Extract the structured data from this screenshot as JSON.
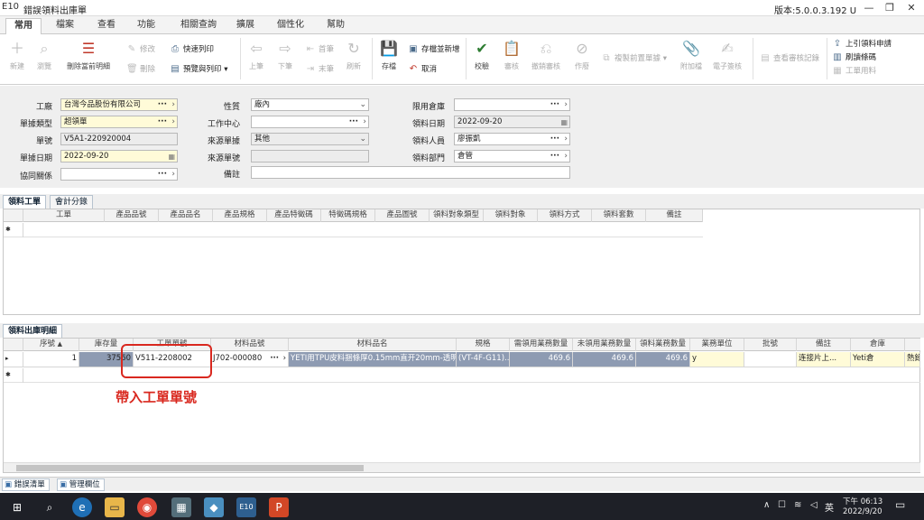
{
  "window": {
    "logo": "E10",
    "title": "錯誤領料出庫單",
    "version": "版本:5.0.0.3.192 U",
    "min": "—",
    "restore": "❐",
    "close": "✕"
  },
  "menu": [
    "常用",
    "檔案",
    "查看",
    "功能",
    "相關查詢",
    "擴展",
    "個性化",
    "幫助"
  ],
  "ribbon": {
    "new": "新建",
    "browse": "瀏覽",
    "delete_current": "刪除當前明細",
    "modify": "修改",
    "remove": "刪除",
    "quick_print": "快速列印",
    "preview_print": "預覽與列印",
    "prev": "上筆",
    "next": "下筆",
    "first": "首筆",
    "last": "末筆",
    "refresh": "刷新",
    "save": "存檔",
    "save_new": "存檔並新增",
    "cancel": "取消",
    "validate": "校驗",
    "review": "審核",
    "unreview": "撤銷審核",
    "void": "作廢",
    "copy_prev": "複製前置單據",
    "attach": "附加檔",
    "esign": "電子簽核",
    "view_review": "查看審核記錄",
    "cite_request": "上引領料申請",
    "barcode": "刷讀條碼",
    "wo_material": "工單用料"
  },
  "form": {
    "factory_label": "工廠",
    "factory": "台灣今品股份有限公司",
    "doctype_label": "單據類型",
    "doctype": "超領單",
    "docno_label": "單號",
    "docno": "V5A1-220920004",
    "docdate_label": "單據日期",
    "docdate": "2022-09-20",
    "partner_label": "協同關係",
    "partner": "",
    "nature_label": "性質",
    "nature": "廠內",
    "workcenter_label": "工作中心",
    "workcenter": "",
    "srctype_label": "來源單據",
    "srctype": "其他",
    "srcno_label": "來源單號",
    "srcno": "",
    "remark_label": "備註",
    "remark": "",
    "warehouse_label": "限用倉庫",
    "warehouse": "",
    "pickdate_label": "領料日期",
    "pickdate": "2022-09-20",
    "picker_label": "領料人員",
    "picker": "廖振凱",
    "pickdept_label": "領料部門",
    "pickdept": "倉管"
  },
  "tabs1": [
    "領料工單",
    "會計分錄"
  ],
  "grid1": {
    "headers": [
      "工單",
      "產品品號",
      "產品品名",
      "產品規格",
      "產品特徵碼",
      "特徵碼規格",
      "產品圖號",
      "領料對象類型",
      "領料對象",
      "領料方式",
      "領料套數",
      "備註"
    ],
    "newrow": "✱"
  },
  "tab2": "領料出庫明細",
  "grid2": {
    "headers": [
      "序號",
      "庫存量",
      "工單單號",
      "材料品號",
      "材料品名",
      "規格",
      "需領用業務數量",
      "未領用業務數量",
      "領料業務數量",
      "業務單位",
      "批號",
      "備註",
      "倉庫"
    ],
    "row": {
      "seq": "1",
      "stock": "37560",
      "wo": "V511-2208002",
      "mat": "J702-000080",
      "matname": "YETI用TPU皮料捆條厚0.15mm直开20mm-透明",
      "spec": "(VT-4F-G11)...",
      "need": "469.6",
      "notyet": "469.6",
      "pick": "469.6",
      "unit": "y",
      "lot": "",
      "remark": "连接片上...",
      "wh": "Yeti倉",
      "extra": "熱錄"
    },
    "newrow": "✱"
  },
  "annotation": "帶入工單單號",
  "bottom": [
    "錯誤清單",
    "管理欄位"
  ],
  "tray": {
    "ime": "英",
    "time": "下午 06:13",
    "date": "2022/9/20"
  },
  "colors": {
    "highlight": "#d9281f",
    "selectedRow": "#8e9bb2",
    "yellow": "#fffbd8"
  }
}
